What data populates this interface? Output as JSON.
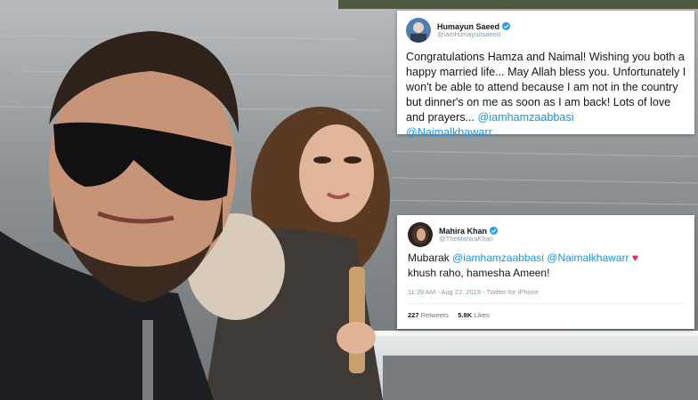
{
  "tweet1": {
    "name": "Humayun Saeed",
    "handle": "@iamhumayunsaeed",
    "text_main": "Congratulations Hamza and Naimal! Wishing you both a happy married life... May Allah bless you. Unfortunately I won't be able to attend because I am not in the country but dinner's on me as soon as I am back! Lots of love and prayers... ",
    "mention1": "@iamhamzaabbasi",
    "mention2": "@Naimalkhawarr",
    "verified_icon": "verified-badge-icon"
  },
  "tweet2": {
    "name": "Mahira Khan",
    "handle": "@TheMahiraKhan",
    "word": "Mubarak ",
    "mention1": "@iamhamzaabbasi",
    "mention2": "@Naimalkhawarr",
    "heart": "♥",
    "line2": "khush raho, hamesha Ameen!",
    "timestamp": "11:39 AM - Aug 22, 2019 - Twitter for iPhone",
    "retweets_count": "227",
    "retweets_label": "Retweets",
    "likes_count": "5.8K",
    "likes_label": "Likes",
    "verified_icon": "verified-badge-icon"
  },
  "colors": {
    "link": "#1b95e0",
    "verified": "#1da1f2",
    "heart": "#e0245e",
    "water": "#8a8f93"
  }
}
